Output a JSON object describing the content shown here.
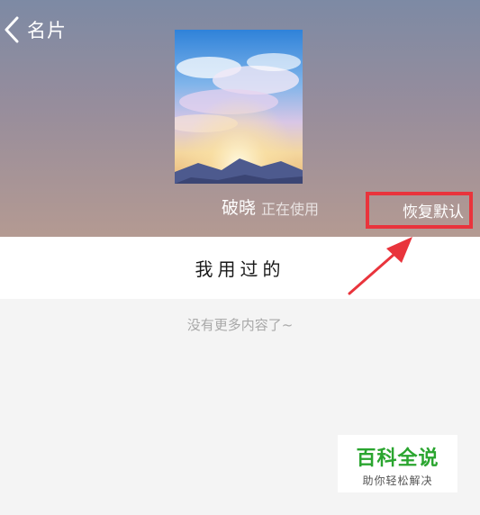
{
  "header": {
    "back_icon": "chevron-left-icon",
    "title": "名片"
  },
  "current_card": {
    "name": "破晓",
    "status": "正在使用",
    "restore_label": "恢复默认"
  },
  "used_section": {
    "title": "我用过的",
    "empty_hint": "没有更多内容了~"
  },
  "watermark": {
    "logo": "百科全说",
    "subtitle": "助你轻松解决"
  },
  "colors": {
    "highlight_red": "#e9343c",
    "watermark_green": "#2aa52f"
  }
}
